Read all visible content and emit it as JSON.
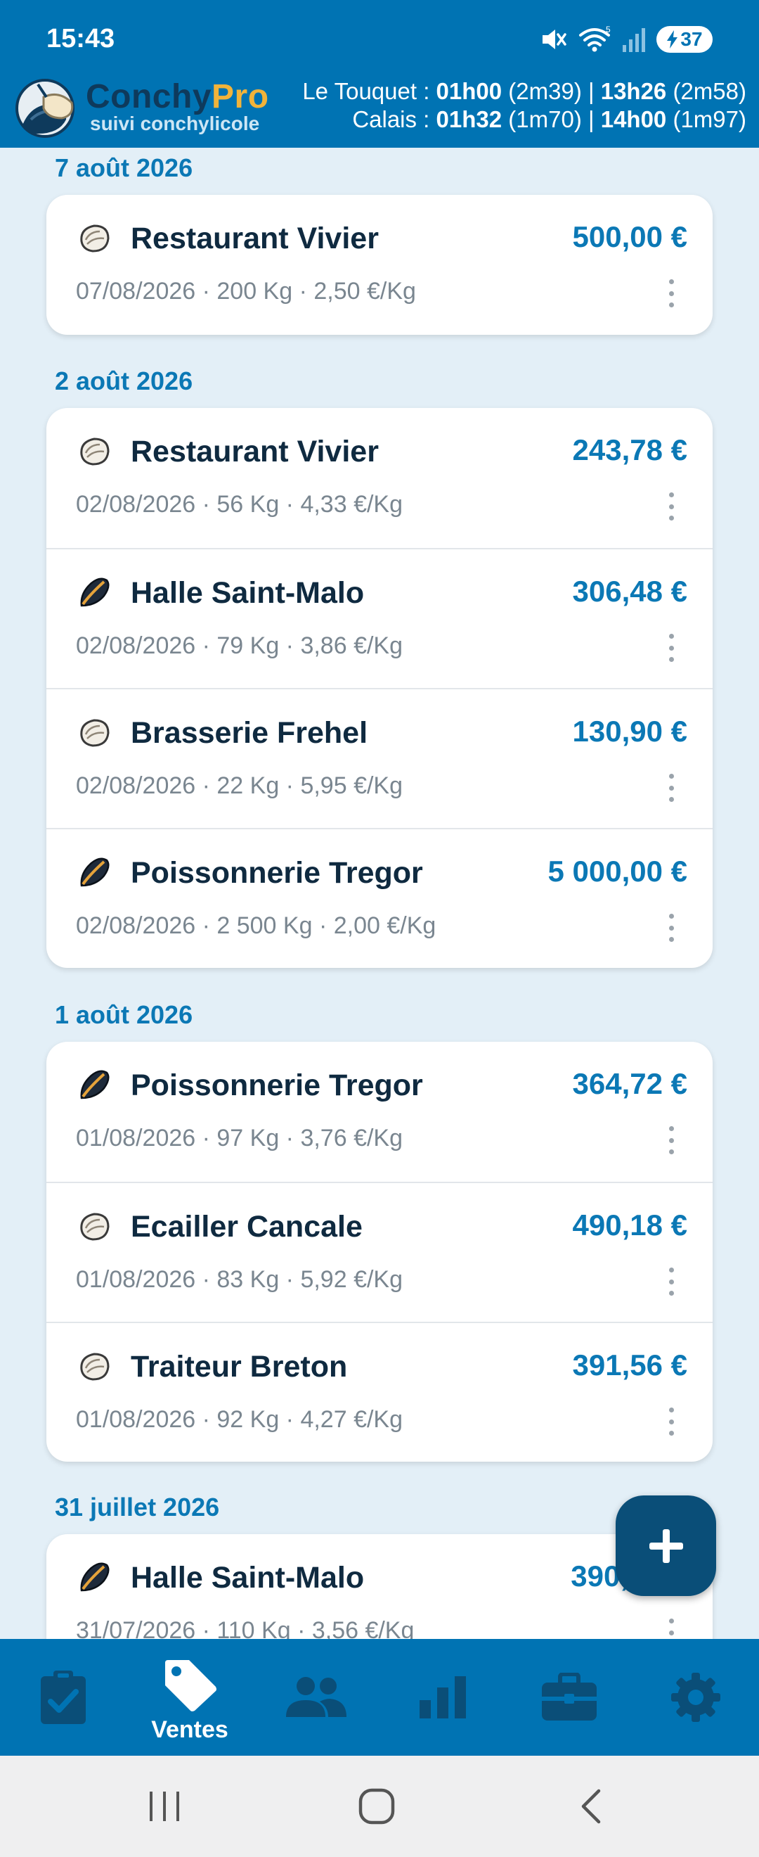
{
  "status_bar": {
    "time": "15:43",
    "network": "5",
    "battery": "37",
    "icons": [
      "mute-icon",
      "wifi-icon",
      "signal-icon",
      "battery-icon"
    ]
  },
  "app": {
    "brand_part1": "Conchy",
    "brand_part2": "Pro",
    "subtitle": "suivi conchylicole",
    "tides": {
      "line1": {
        "place": "Le Touquet : ",
        "t1": "01h00",
        "h1": " (2m39) | ",
        "t2": "13h26",
        "h2": " (2m58)"
      },
      "line2": {
        "place": "Calais : ",
        "t1": "01h32",
        "h1": " (1m70) | ",
        "t2": "14h00",
        "h2": " (1m97)"
      }
    }
  },
  "groups": [
    {
      "date": "7 août 2026",
      "sales": [
        {
          "icon": "oyster-icon",
          "name": "Restaurant Vivier",
          "amount": "500,00 €",
          "detail": "07/08/2026 · 200 Kg · 2,50 €/Kg"
        }
      ]
    },
    {
      "date": "2 août 2026",
      "sales": [
        {
          "icon": "oyster-icon",
          "name": "Restaurant Vivier",
          "amount": "243,78 €",
          "detail": "02/08/2026 · 56 Kg · 4,33 €/Kg"
        },
        {
          "icon": "mussel-icon",
          "name": "Halle Saint-Malo",
          "amount": "306,48 €",
          "detail": "02/08/2026 · 79 Kg · 3,86 €/Kg"
        },
        {
          "icon": "oyster-icon",
          "name": "Brasserie Frehel",
          "amount": "130,90 €",
          "detail": "02/08/2026 · 22 Kg · 5,95 €/Kg"
        },
        {
          "icon": "mussel-icon",
          "name": "Poissonnerie Tregor",
          "amount": "5 000,00 €",
          "detail": "02/08/2026 · 2 500 Kg · 2,00 €/Kg"
        }
      ]
    },
    {
      "date": "1 août 2026",
      "sales": [
        {
          "icon": "mussel-icon",
          "name": "Poissonnerie Tregor",
          "amount": "364,72 €",
          "detail": "01/08/2026 · 97 Kg · 3,76 €/Kg"
        },
        {
          "icon": "oyster-icon",
          "name": "Ecailler Cancale",
          "amount": "490,18 €",
          "detail": "01/08/2026 · 83 Kg · 5,92 €/Kg"
        },
        {
          "icon": "oyster-icon",
          "name": "Traiteur Breton",
          "amount": "391,56 €",
          "detail": "01/08/2026 · 92 Kg · 4,27 €/Kg"
        }
      ]
    },
    {
      "date": "31 juillet 2026",
      "sales": [
        {
          "icon": "mussel-icon",
          "name": "Halle Saint-Malo",
          "amount": "390,",
          "detail": "31/07/2026 · 110 Kg · 3,56 €/Kg"
        }
      ]
    }
  ],
  "fab": {
    "icon": "plus-icon",
    "label": "+"
  },
  "bottom_nav": [
    {
      "icon": "clipboard-check-icon",
      "label": "",
      "active": false
    },
    {
      "icon": "tag-icon",
      "label": "Ventes",
      "active": true
    },
    {
      "icon": "people-icon",
      "label": "",
      "active": false
    },
    {
      "icon": "bar-chart-icon",
      "label": "",
      "active": false
    },
    {
      "icon": "briefcase-icon",
      "label": "",
      "active": false
    },
    {
      "icon": "gear-icon",
      "label": "",
      "active": false
    }
  ],
  "system_nav": [
    "recents-icon",
    "home-icon",
    "back-icon"
  ],
  "colors": {
    "primary": "#0073B3",
    "accent_amount": "#0B78B5",
    "fab": "#0A4E78",
    "nav_active": "#FFFFFF",
    "nav_inactive": "#0A4E78",
    "background": "#E3EFF7"
  }
}
